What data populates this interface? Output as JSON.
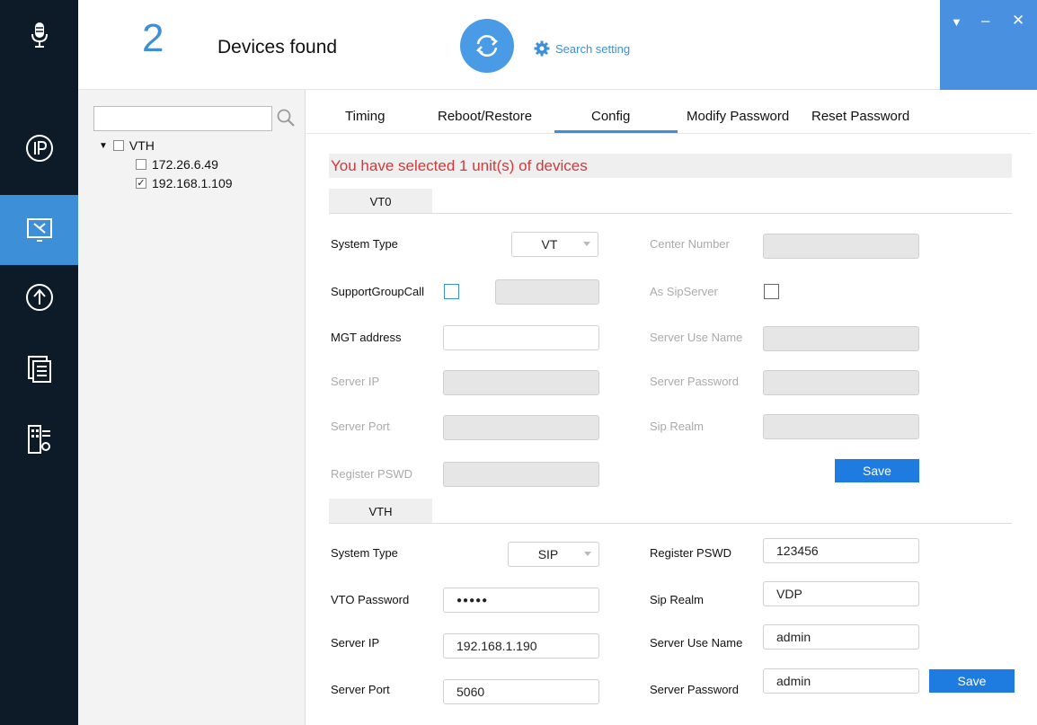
{
  "header": {
    "device_count": "2",
    "devices_found_label": "Devices found",
    "search_setting_label": "Search setting"
  },
  "tree": {
    "search_placeholder": "",
    "root_label": "VTH",
    "items": [
      {
        "label": "172.26.6.49",
        "checked": false
      },
      {
        "label": "192.168.1.109",
        "checked": true
      }
    ]
  },
  "tabs": [
    "Timing",
    "Reboot/Restore",
    "Config",
    "Modify Password",
    "Reset Password"
  ],
  "active_tab": "Config",
  "selection_message": "You have selected 1 unit(s) of devices",
  "vto": {
    "section_label": "VT0",
    "system_type_label": "System Type",
    "system_type_value": "VT",
    "center_number_label": "Center Number",
    "support_group_call_label": "SupportGroupCall",
    "as_sip_server_label": "As SipServer",
    "mgt_address_label": "MGT address",
    "server_use_name_label": "Server Use Name",
    "server_ip_label": "Server IP",
    "server_password_label": "Server Password",
    "server_port_label": "Server Port",
    "sip_realm_label": "Sip Realm",
    "register_pswd_label": "Register PSWD",
    "save_label": "Save"
  },
  "vth": {
    "section_label": "VTH",
    "system_type_label": "System Type",
    "system_type_value": "SIP",
    "register_pswd_label": "Register PSWD",
    "register_pswd_value": "123456",
    "vto_password_label": "VTO Password",
    "vto_password_value": "●●●●●",
    "sip_realm_label": "Sip Realm",
    "sip_realm_value": "VDP",
    "server_ip_label": "Server IP",
    "server_ip_value": "192.168.1.190",
    "server_use_name_label": "Server Use Name",
    "server_use_name_value": "admin",
    "server_port_label": "Server Port",
    "server_port_value": "5060",
    "server_password_label": "Server Password",
    "server_password_value": "admin",
    "save_label": "Save"
  },
  "colors": {
    "accent": "#3d8fd8",
    "rail_bg": "#0d1b29",
    "warning_text": "#d13a3a",
    "save_button": "#1e7be0"
  }
}
